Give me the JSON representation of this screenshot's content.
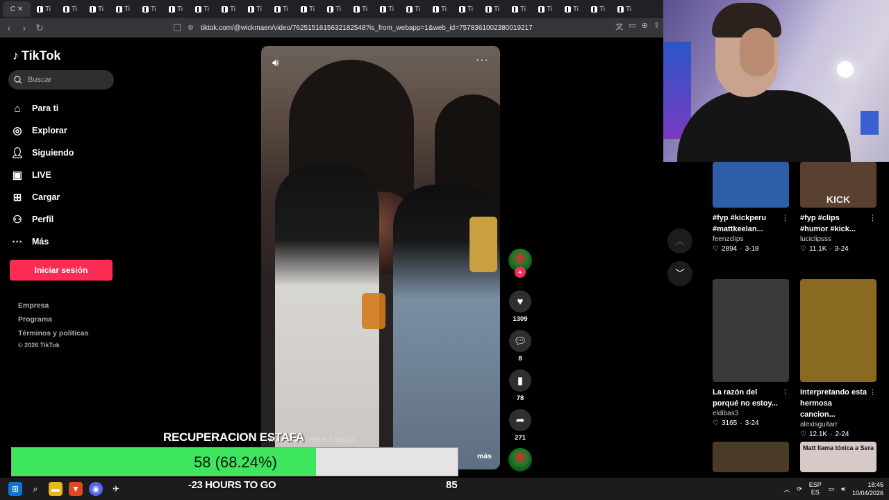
{
  "browser": {
    "active_tab_label": "C",
    "tab_label": "Ti",
    "tab_count": 23,
    "url": "tiktok.com/@wickmaen/video/7625151615632182548?is_from_webapp=1&web_id=7578361002380019217"
  },
  "sidebar": {
    "logo": "TikTok",
    "search_placeholder": "Buscar",
    "items": [
      {
        "label": "Para ti",
        "icon": "home-icon"
      },
      {
        "label": "Explorar",
        "icon": "compass-icon"
      },
      {
        "label": "Siguiendo",
        "icon": "user-follow-icon"
      },
      {
        "label": "LIVE",
        "icon": "live-icon"
      },
      {
        "label": "Cargar",
        "icon": "upload-icon"
      },
      {
        "label": "Perfil",
        "icon": "profile-icon"
      },
      {
        "label": "Más",
        "icon": "more-icon"
      }
    ],
    "login_label": "Iniciar sesión",
    "footer": [
      "Empresa",
      "Programa",
      "Términos y políticas"
    ],
    "copyright": "© 2026 TikTok"
  },
  "video": {
    "author": "wickmaen",
    "time_ago": "· Hace 5 día(s)",
    "more_label": "más",
    "likes": "1309",
    "comments": "8",
    "saves": "78",
    "shares": "271"
  },
  "recommendations": [
    {
      "title": "#fyp #kickperu #mattkeelan...",
      "author": "feenzclips",
      "likes": "2894",
      "date": "3-18",
      "thumb_color": "#2d5fa8"
    },
    {
      "title": "#fyp #clips #humor #kick...",
      "author": "luciclipsss",
      "likes": "11.1K",
      "date": "3-24",
      "thumb_color": "#5a4030",
      "thumb_text": "KICK"
    },
    {
      "title": "La razón del porqué no estoy...",
      "author": "eldibas3",
      "likes": "3165",
      "date": "3-24",
      "thumb_color": "#3a3a3a"
    },
    {
      "title": "Interpretando esta hermosa cancion...",
      "author": "alexisguitarr",
      "likes": "12.1K",
      "date": "2-24",
      "thumb_color": "#8a6a20"
    },
    {
      "title": "",
      "author": "",
      "likes": "",
      "date": "",
      "thumb_color": "#4a3a28"
    },
    {
      "title": "",
      "author": "",
      "likes": "",
      "date": "",
      "thumb_color": "#d9c8c8",
      "thumb_text": "Matt llama tóxica a Sera"
    }
  ],
  "overlay": {
    "title": "RECUPERACION ESTAFA",
    "progress_text": "58 (68.24%)",
    "progress_fraction": 0.6824,
    "hours_text": "-23 HOURS TO GO",
    "goal": "85",
    "fill_color": "#3ee65e"
  },
  "taskbar": {
    "lang_top": "ESP",
    "lang_bottom": "ES",
    "time": "18:45",
    "date": "10/04/2026"
  }
}
